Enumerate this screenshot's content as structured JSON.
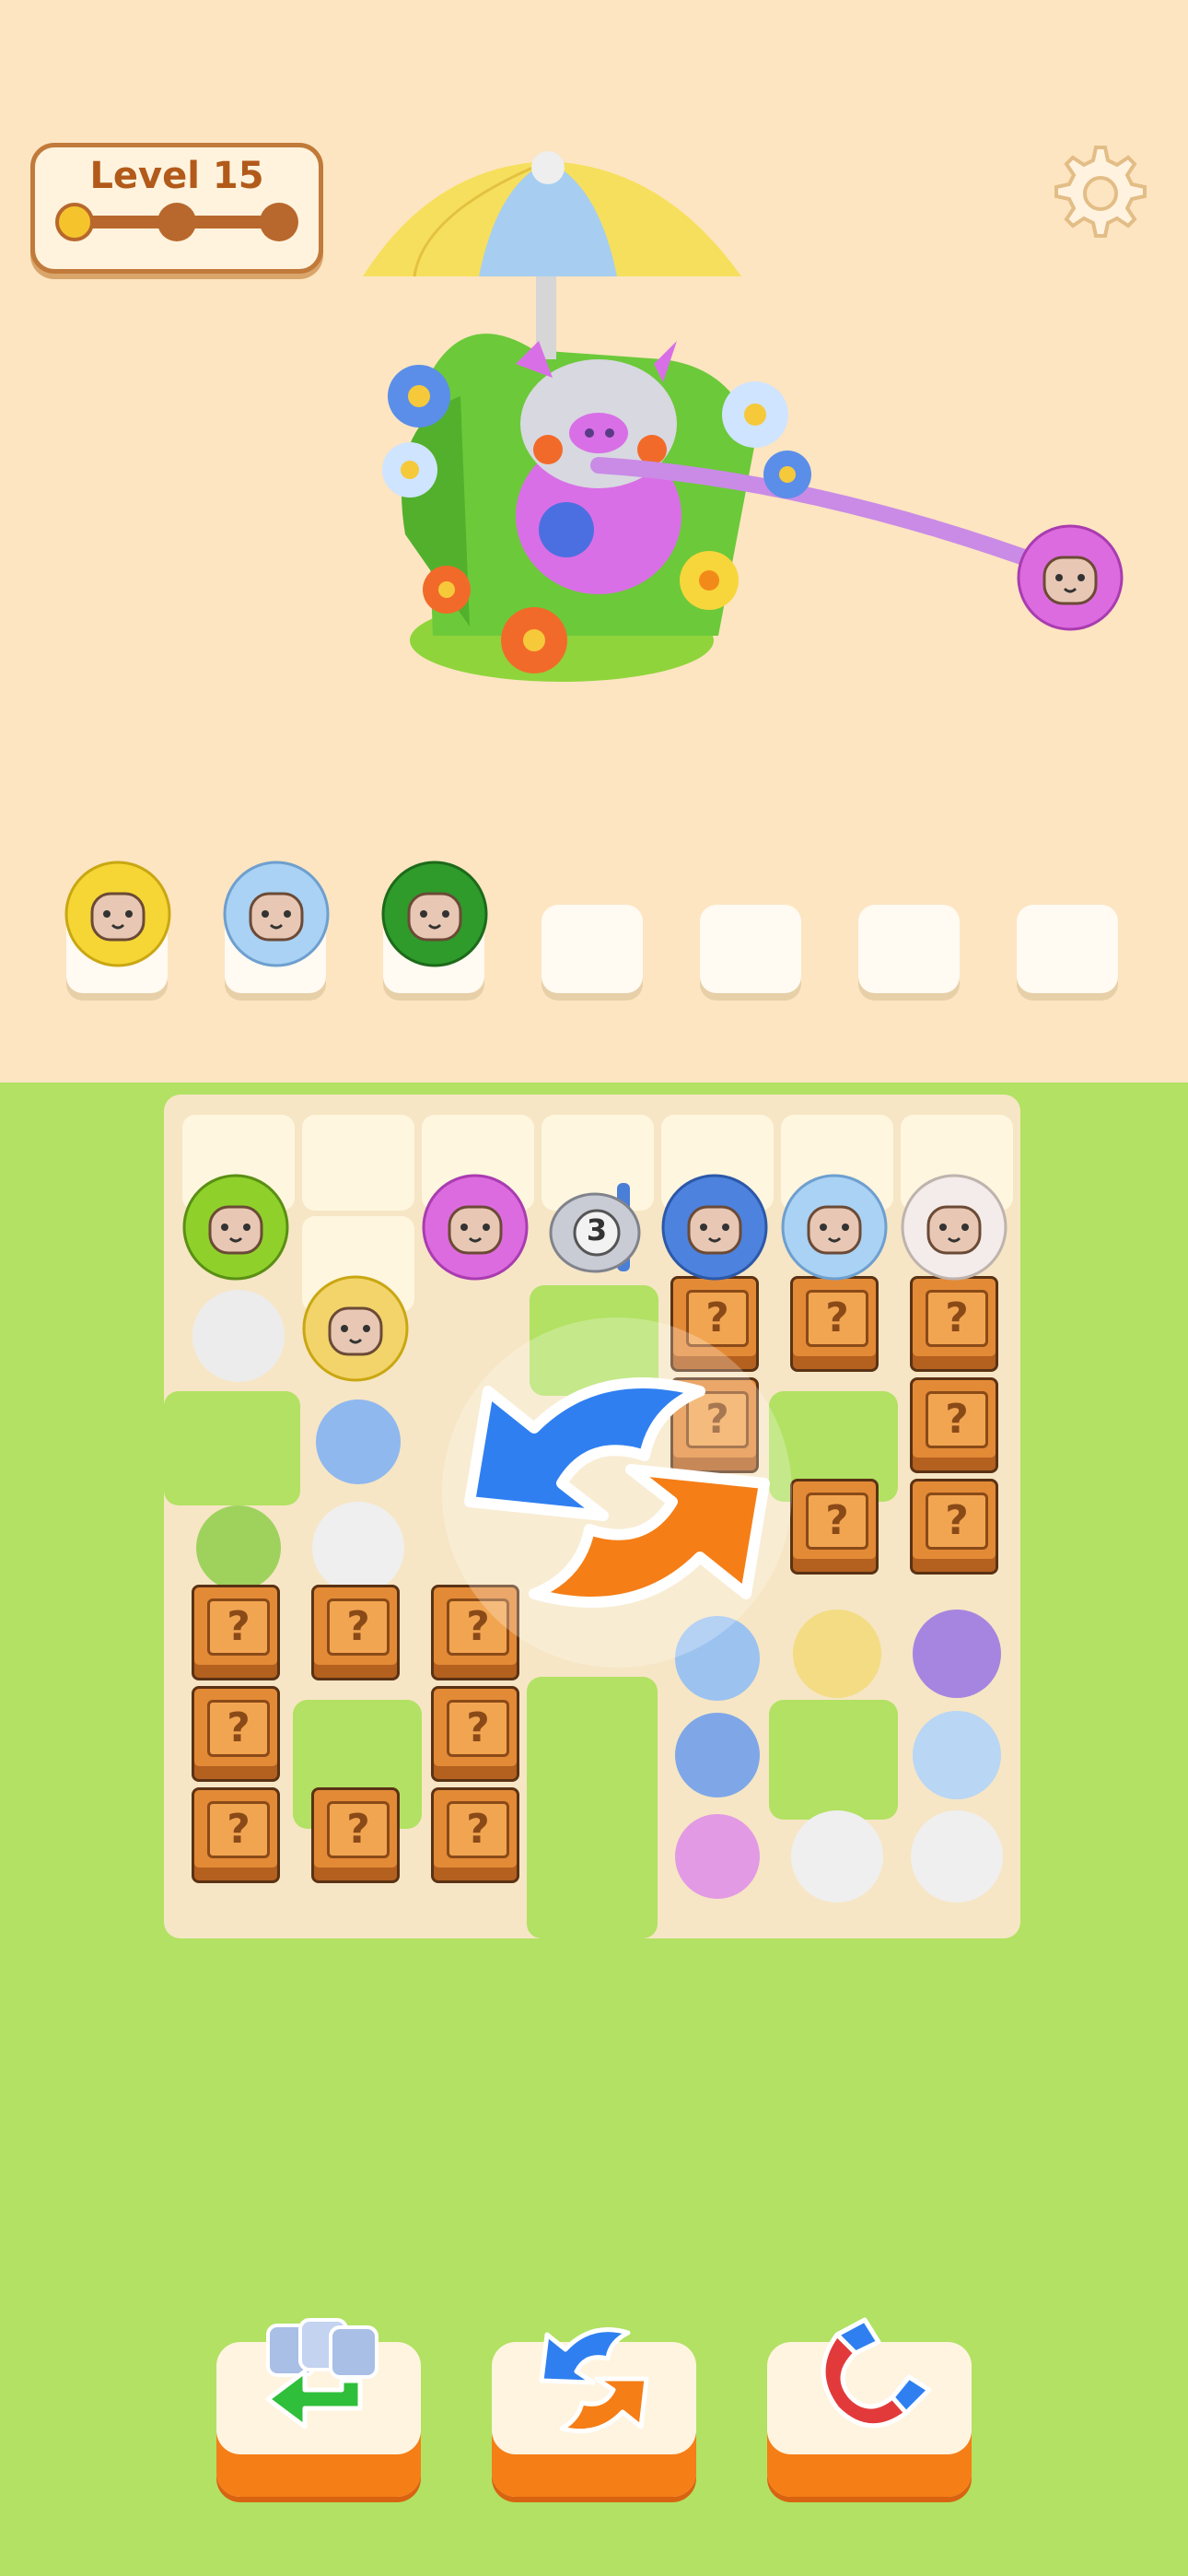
{
  "level": {
    "title": "Level 15",
    "progress_step": 1,
    "progress_total": 3
  },
  "board_counter": "3",
  "queue": {
    "filled": [
      "yellow-sheep",
      "light-blue-sheep",
      "green-sheep"
    ],
    "empty_slots": 4
  },
  "board": {
    "top_sheep": [
      "lime",
      "yellow",
      "pink",
      "counter-3",
      "blue",
      "light-blue",
      "white"
    ]
  },
  "tools": {
    "undo": "undo-icon",
    "shuffle": "shuffle-icon",
    "magnet": "magnet-icon"
  },
  "colors": {
    "background": "#fde5c1",
    "grass": "#b2e163",
    "accent": "#f57e16",
    "badge_text": "#b25a1a"
  }
}
